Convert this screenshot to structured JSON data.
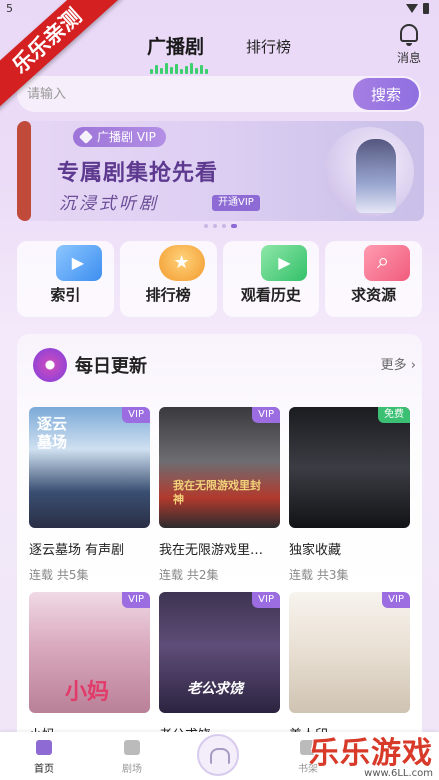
{
  "status_bar": {
    "time": "5"
  },
  "ribbon": {
    "text": "乐乐亲测"
  },
  "header": {
    "tab_active": "广播剧",
    "tab_other": "排行榜",
    "message_label": "消息"
  },
  "search": {
    "placeholder": "请输入",
    "button": "搜索"
  },
  "banner": {
    "pill": "广播剧 VIP",
    "title": "专属剧集抢先看",
    "subtitle": "沉浸式听剧",
    "open_button": "开通VIP"
  },
  "quick_actions": [
    {
      "label": "索引",
      "icon": "video-index-icon"
    },
    {
      "label": "排行榜",
      "icon": "trophy-icon"
    },
    {
      "label": "观看历史",
      "icon": "history-icon"
    },
    {
      "label": "求资源",
      "icon": "search-resource-icon"
    }
  ],
  "daily": {
    "title": "每日更新",
    "more": "更多",
    "items": [
      {
        "title": "逐云墓场 有声剧",
        "meta": "连载 共5集",
        "badge": "VIP",
        "cover_text": "逐云墓场"
      },
      {
        "title": "我在无限游戏里…",
        "meta": "连载 共2集",
        "badge": "VIP",
        "cover_text": "我在无限游戏里封神"
      },
      {
        "title": "独家收藏",
        "meta": "连载 共3集",
        "badge": "免费",
        "cover_text": ""
      },
      {
        "title": "小妈",
        "meta": "",
        "badge": "VIP",
        "cover_text": "小妈"
      },
      {
        "title": "老公求饶",
        "meta": "",
        "badge": "VIP",
        "cover_text": "老公求饶"
      },
      {
        "title": "美人印",
        "meta": "",
        "badge": "VIP",
        "cover_text": ""
      }
    ]
  },
  "bottom_nav": [
    {
      "label": "首页",
      "active": true
    },
    {
      "label": "剧场",
      "active": false
    },
    {
      "label": "书架",
      "active": false
    }
  ],
  "watermark": {
    "big": "乐乐游戏",
    "small": "www.6LL.com"
  },
  "colors": {
    "accent": "#8d6ad4",
    "vip_badge": "#9b6de0",
    "free_badge": "#3bbf73",
    "ribbon": "#d42020"
  }
}
